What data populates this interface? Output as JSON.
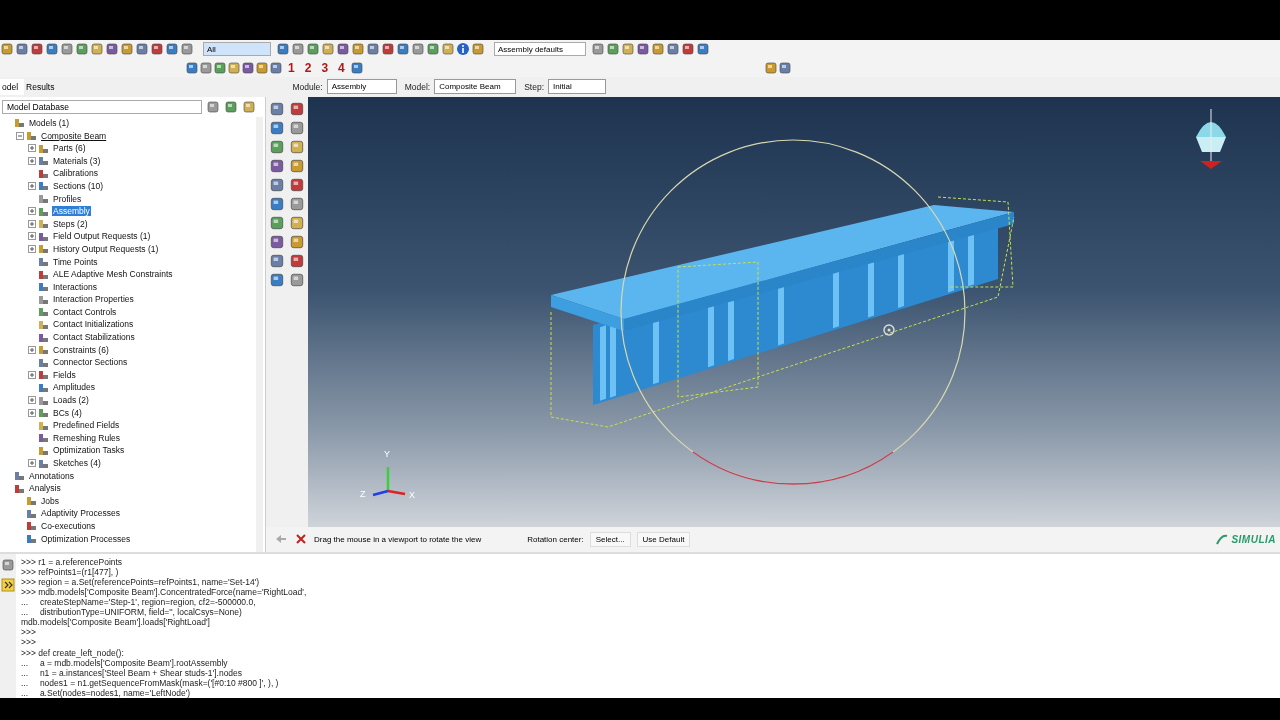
{
  "toolbar": {
    "selection_filter": "All",
    "render_style": "Assembly defaults",
    "view_numbers": [
      "1",
      "2",
      "3",
      "4"
    ]
  },
  "tabs": [
    {
      "label": "odel",
      "selected": true
    },
    {
      "label": "Results",
      "selected": false
    }
  ],
  "context_bar": [
    {
      "label": "Module:",
      "value": "Assembly"
    },
    {
      "label": "Model:",
      "value": "Composite Beam"
    },
    {
      "label": "Step:",
      "value": "Initial"
    }
  ],
  "model_tree": {
    "source": "Model Database",
    "items": [
      {
        "label": "Models (1)",
        "selected": false,
        "children": [
          {
            "label": "Composite Beam",
            "selected": false,
            "expanded": true,
            "underlined": true,
            "children": [
              {
                "label": "Parts (6)",
                "selected": false,
                "expanded": false
              },
              {
                "label": "Materials (3)",
                "selected": false,
                "expanded": false
              },
              {
                "label": "Calibrations",
                "selected": false
              },
              {
                "label": "Sections (10)",
                "selected": false,
                "expanded": false
              },
              {
                "label": "Profiles",
                "selected": false
              },
              {
                "label": "Assembly",
                "selected": true,
                "expanded": false
              },
              {
                "label": "Steps (2)",
                "selected": false,
                "expanded": false
              },
              {
                "label": "Field Output Requests (1)",
                "selected": false,
                "expanded": false
              },
              {
                "label": "History Output Requests (1)",
                "selected": false,
                "expanded": false
              },
              {
                "label": "Time Points",
                "selected": false
              },
              {
                "label": "ALE Adaptive Mesh Constraints",
                "selected": false
              },
              {
                "label": "Interactions",
                "selected": false
              },
              {
                "label": "Interaction Properties",
                "selected": false
              },
              {
                "label": "Contact Controls",
                "selected": false
              },
              {
                "label": "Contact Initializations",
                "selected": false
              },
              {
                "label": "Contact Stabilizations",
                "selected": false
              },
              {
                "label": "Constraints (6)",
                "selected": false,
                "expanded": false
              },
              {
                "label": "Connector Sections",
                "selected": false
              },
              {
                "label": "Fields",
                "selected": false,
                "expanded": false
              },
              {
                "label": "Amplitudes",
                "selected": false
              },
              {
                "label": "Loads (2)",
                "selected": false,
                "expanded": false
              },
              {
                "label": "BCs (4)",
                "selected": false,
                "expanded": false
              },
              {
                "label": "Predefined Fields",
                "selected": false
              },
              {
                "label": "Remeshing Rules",
                "selected": false
              },
              {
                "label": "Optimization Tasks",
                "selected": false
              },
              {
                "label": "Sketches (4)",
                "selected": false,
                "expanded": false
              }
            ]
          }
        ]
      },
      {
        "label": "Annotations",
        "selected": false
      },
      {
        "label": "Analysis",
        "selected": false,
        "children": [
          {
            "label": "Jobs",
            "selected": false
          },
          {
            "label": "Adaptivity Processes",
            "selected": false
          },
          {
            "label": "Co-executions",
            "selected": false
          },
          {
            "label": "Optimization Processes",
            "selected": false
          }
        ]
      }
    ]
  },
  "viewport": {
    "triad_labels": [
      "Y",
      "Z",
      "X"
    ]
  },
  "prompt": {
    "message": "Drag the mouse in a viewport to rotate the view",
    "rotation_label": "Rotation center:",
    "buttons": [
      "Select...",
      "Use Default"
    ]
  },
  "brand": "SIMULIA",
  "console": {
    "lines": [
      ">>> r1 = a.referencePoints",
      ">>> refPoints1=(r1[477], )",
      ">>> region = a.Set(referencePoints=refPoints1, name='Set-14')",
      ">>> mdb.models['Composite Beam'].ConcentratedForce(name='RightLoad',",
      "...     createStepName='Step-1', region=region, cf2=-500000.0,",
      "...     distributionType=UNIFORM, field='', localCsys=None)",
      "mdb.models['Composite Beam'].loads['RightLoad']",
      ">>>",
      ">>>",
      ">>> def create_left_node():",
      "...     a = mdb.models['Composite Beam'].rootAssembly",
      "...     n1 = a.instances['Steel Beam + Shear studs-1'].nodes",
      "...     nodes1 = n1.getSequenceFromMask(mask=('[#0:10 #800 ]', ), )",
      "...     a.Set(nodes=nodes1, name='LeftNode')"
    ]
  }
}
